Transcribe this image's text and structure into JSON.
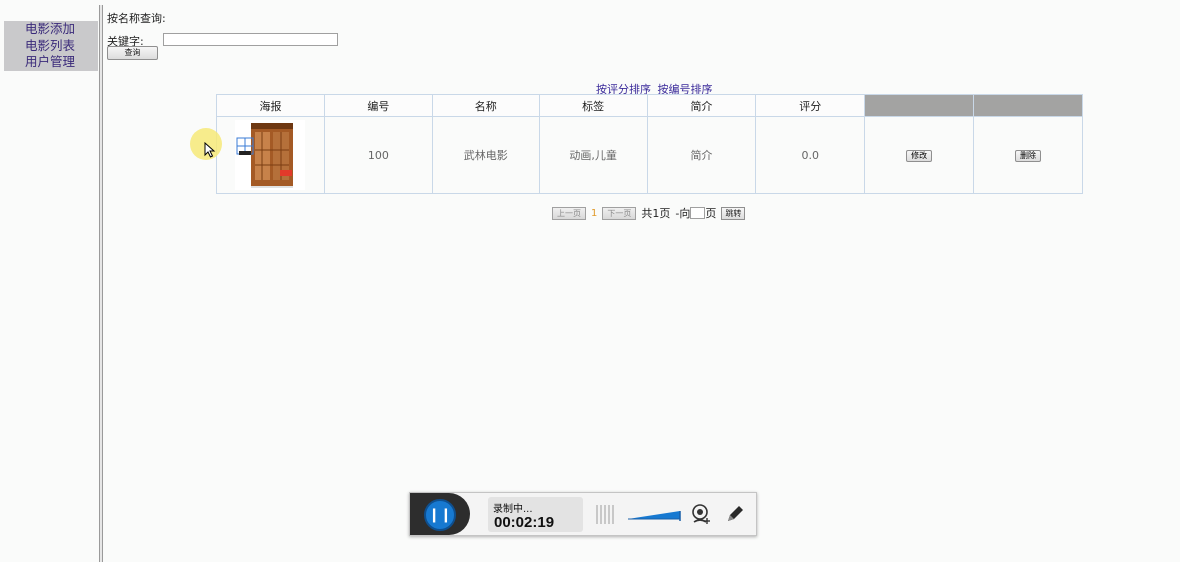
{
  "sidebar": {
    "items": [
      {
        "label": "电影添加"
      },
      {
        "label": "电影列表"
      },
      {
        "label": "用户管理"
      }
    ]
  },
  "search": {
    "title": "按名称查询:",
    "keyword_label": "关键字:",
    "keyword_value": "",
    "button_label": "查询"
  },
  "sort": {
    "by_rating": "按评分排序",
    "by_id": "按编号排序"
  },
  "table": {
    "headers": [
      "海报",
      "编号",
      "名称",
      "标签",
      "简介",
      "评分"
    ],
    "rows": [
      {
        "poster_icon": "cabinet-poster-image",
        "id": "100",
        "name": "武林电影",
        "tags": "动画,儿童",
        "intro": "简介",
        "rating": "0.0",
        "edit_label": "修改",
        "delete_label": "删除"
      }
    ]
  },
  "pager": {
    "prev_label": "上一页",
    "current_page": "1",
    "next_label": "下一页",
    "total_text": "共1页",
    "goto_prefix": "-向",
    "goto_suffix": "页",
    "goto_value": "",
    "jump_label": "跳转"
  },
  "recorder": {
    "status": "录制中...",
    "elapsed": "00:02:19",
    "pause_icon": "pause-icon",
    "camera_icon": "webcam-icon",
    "pen_icon": "pen-icon",
    "accent_color": "#1779d1"
  }
}
